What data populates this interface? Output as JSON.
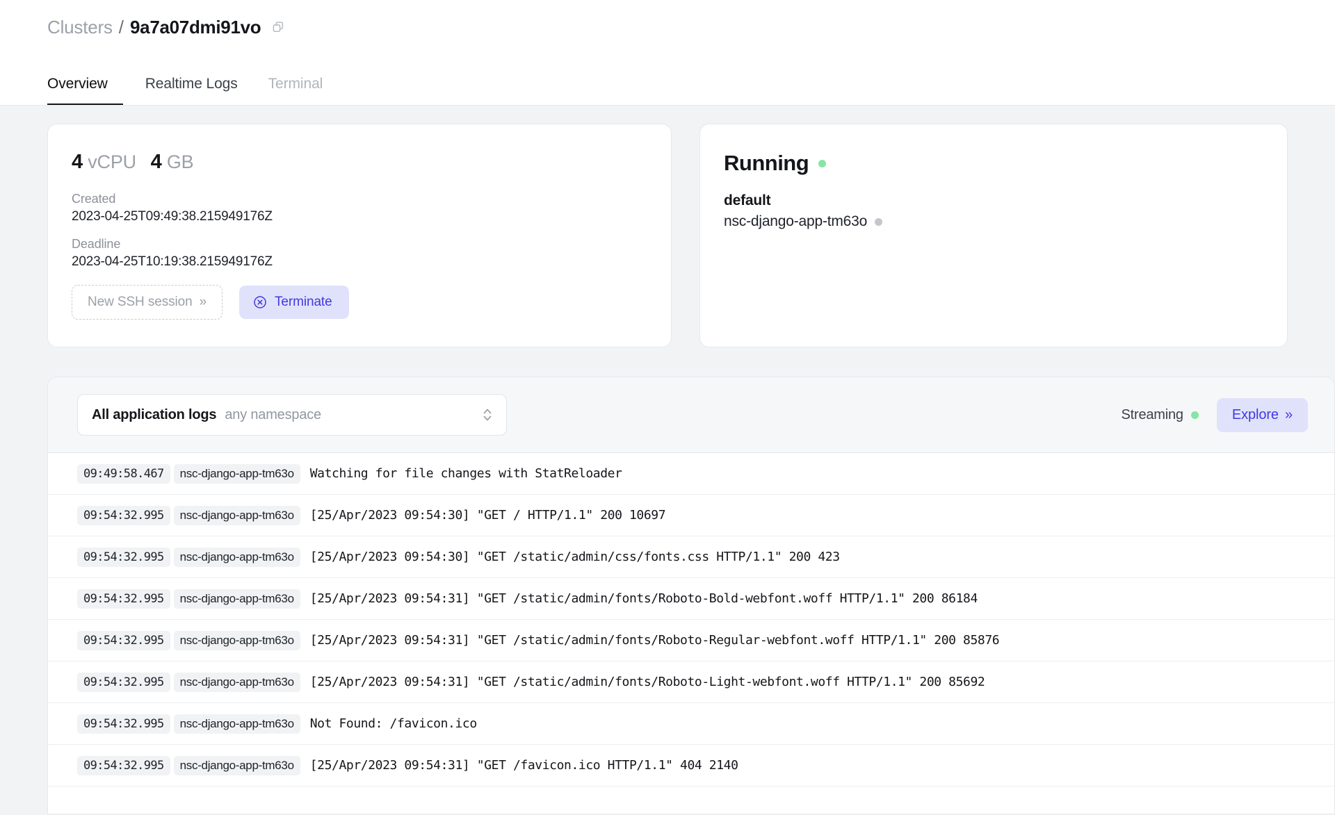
{
  "breadcrumb": {
    "parent": "Clusters",
    "separator": "/",
    "current": "9a7a07dmi91vo",
    "copy_icon": "copy-icon"
  },
  "tabs": [
    {
      "label": "Overview",
      "state": "active"
    },
    {
      "label": "Realtime Logs",
      "state": "default"
    },
    {
      "label": "Terminal",
      "state": "disabled"
    }
  ],
  "cluster_card": {
    "vcpu_count": "4",
    "vcpu_label": "vCPU",
    "memory_count": "4",
    "memory_label": "GB",
    "created_label": "Created",
    "created_value": "2023-04-25T09:49:38.215949176Z",
    "deadline_label": "Deadline",
    "deadline_value": "2023-04-25T10:19:38.215949176Z",
    "ssh_button": "New SSH session",
    "ssh_chevron": "»",
    "terminate_button": "Terminate",
    "terminate_icon": "circle-x-icon",
    "accent": "#4338e0",
    "accent_bg": "#e0e2fb"
  },
  "status_card": {
    "title": "Running",
    "status_dot_color": "#86e5a4",
    "namespace": "default",
    "pod_name": "nsc-django-app-tm63o",
    "pod_dot_color": "#c3c7cd"
  },
  "logs": {
    "filter_main": "All application logs",
    "filter_sub": "any namespace",
    "filter_icon": "chevron-up-down-icon",
    "streaming_label": "Streaming",
    "streaming_dot_color": "#86e5a4",
    "explore_button": "Explore",
    "explore_chevron": "»",
    "rows": [
      {
        "time": "09:49:58.467",
        "pod": "nsc-django-app-tm63o",
        "message": "Watching for file changes with StatReloader"
      },
      {
        "time": "09:54:32.995",
        "pod": "nsc-django-app-tm63o",
        "message": "[25/Apr/2023 09:54:30] \"GET / HTTP/1.1\" 200 10697"
      },
      {
        "time": "09:54:32.995",
        "pod": "nsc-django-app-tm63o",
        "message": "[25/Apr/2023 09:54:30] \"GET /static/admin/css/fonts.css HTTP/1.1\" 200 423"
      },
      {
        "time": "09:54:32.995",
        "pod": "nsc-django-app-tm63o",
        "message": "[25/Apr/2023 09:54:31] \"GET /static/admin/fonts/Roboto-Bold-webfont.woff HTTP/1.1\" 200 86184"
      },
      {
        "time": "09:54:32.995",
        "pod": "nsc-django-app-tm63o",
        "message": "[25/Apr/2023 09:54:31] \"GET /static/admin/fonts/Roboto-Regular-webfont.woff HTTP/1.1\" 200 85876"
      },
      {
        "time": "09:54:32.995",
        "pod": "nsc-django-app-tm63o",
        "message": "[25/Apr/2023 09:54:31] \"GET /static/admin/fonts/Roboto-Light-webfont.woff HTTP/1.1\" 200 85692"
      },
      {
        "time": "09:54:32.995",
        "pod": "nsc-django-app-tm63o",
        "message": "Not Found: /favicon.ico"
      },
      {
        "time": "09:54:32.995",
        "pod": "nsc-django-app-tm63o",
        "message": "[25/Apr/2023 09:54:31] \"GET /favicon.ico HTTP/1.1\" 404 2140"
      }
    ]
  }
}
